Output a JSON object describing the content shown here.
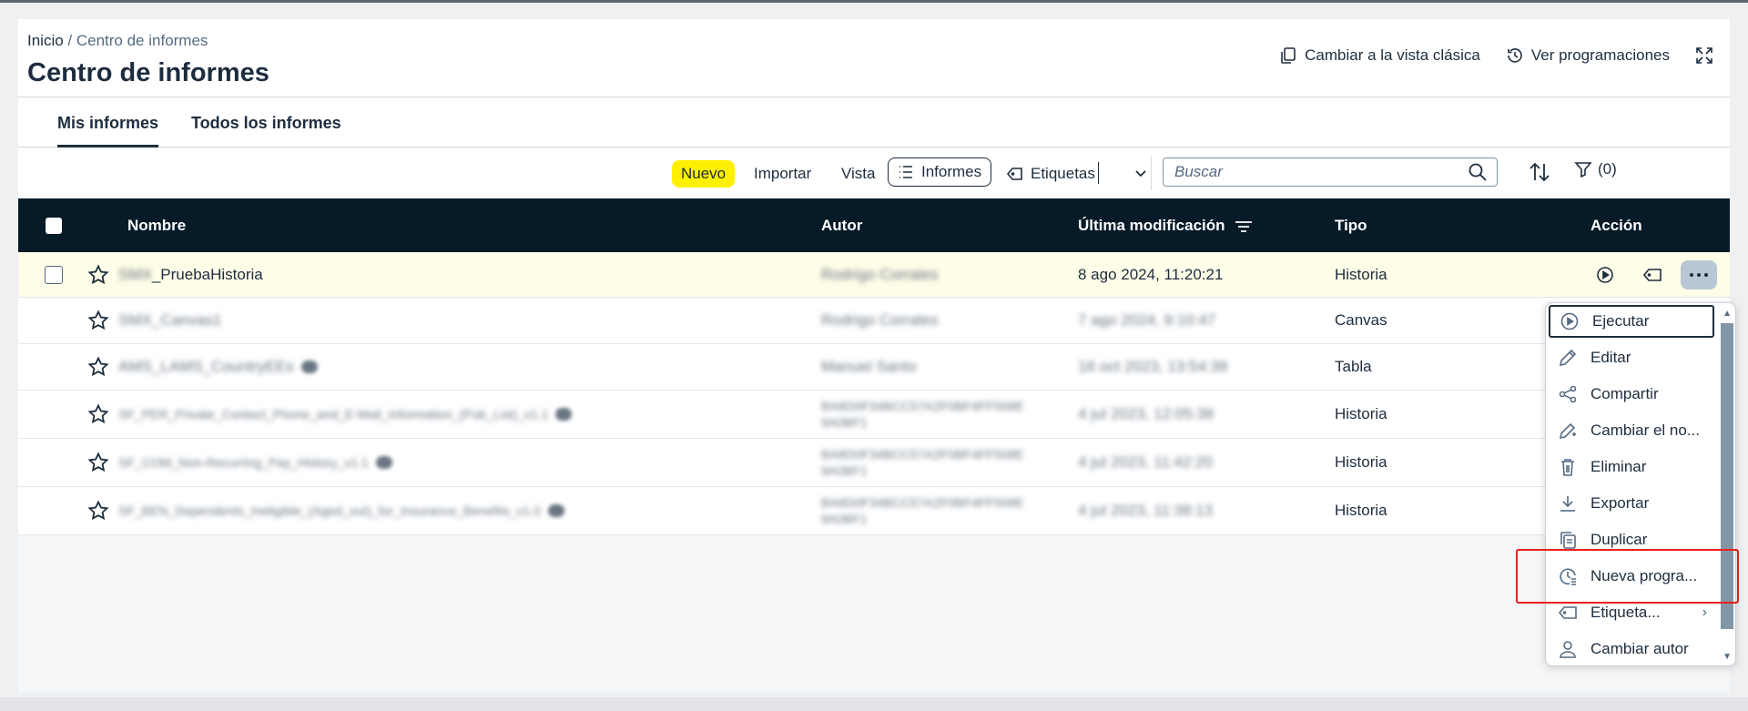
{
  "breadcrumb": {
    "home": "Inicio",
    "separator": " / ",
    "current": "Centro de informes"
  },
  "page_title": "Centro de informes",
  "header_actions": {
    "classic_view": "Cambiar a la vista clásica",
    "schedules": "Ver programaciones"
  },
  "tabs": {
    "mine": "Mis informes",
    "all": "Todos los informes"
  },
  "toolbar": {
    "new": "Nuevo",
    "import": "Importar",
    "view_label": "Vista",
    "view_value": "Informes",
    "tags": "Etiquetas",
    "search_placeholder": "Buscar",
    "filter_count": "(0)"
  },
  "columns": {
    "name": "Nombre",
    "author": "Autor",
    "modified": "Última modificación",
    "type": "Tipo",
    "action": "Acción"
  },
  "rows": [
    {
      "name_prefix": "SMX",
      "name": "_PruebaHistoria",
      "author": "Rodrigo Corrales",
      "date": "8 ago 2024, 11:20:21",
      "type": "Historia"
    },
    {
      "name": "SMX_Canvas1",
      "author": "Rodrigo Corrales",
      "date": "7 ago 2024, 9:10:47",
      "type": "Canvas"
    },
    {
      "name": "AMS_LAMS_CountryEEs",
      "author": "Manuel Santo",
      "date": "18 oct 2023, 13:54:38",
      "type": "Tabla"
    },
    {
      "name": "SF_PER_Private_Contact_Phone_and_E-Mail_Information_(Pub_List)_v1.1",
      "author": "BA8D0F34BCC57A2F0BF4FF508E",
      "author2": "9A0BF1",
      "date": "4 jul 2023, 12:05:38",
      "type": "Historia"
    },
    {
      "name": "SF_COM_Non-Recurring_Pay_History_v1.1",
      "author": "BA8D0F34BCC57A2F0BF4FF508E",
      "author2": "9A0BF1",
      "date": "4 jul 2023, 11:42:20",
      "type": "Historia"
    },
    {
      "name": "SF_BEN_Dependents_Ineligible_(Aged_out)_for_Insurance_Benefits_v1.0",
      "author": "BA8D0F34BCC57A2F0BF4FF508E",
      "author2": "9A0BF1",
      "date": "4 jul 2023, 11:38:13",
      "type": "Historia"
    }
  ],
  "menu": {
    "run": "Ejecutar",
    "edit": "Editar",
    "share": "Compartir",
    "rename": "Cambiar el no...",
    "delete": "Eliminar",
    "export": "Exportar",
    "duplicate": "Duplicar",
    "schedule": "Nueva progra...",
    "tags": "Etiqueta...",
    "change_author": "Cambiar autor"
  },
  "colors": {
    "header_bg": "#061a28",
    "accent_new": "#fff000",
    "highlight": "#e8211c",
    "selected_row": "#fefde8"
  }
}
